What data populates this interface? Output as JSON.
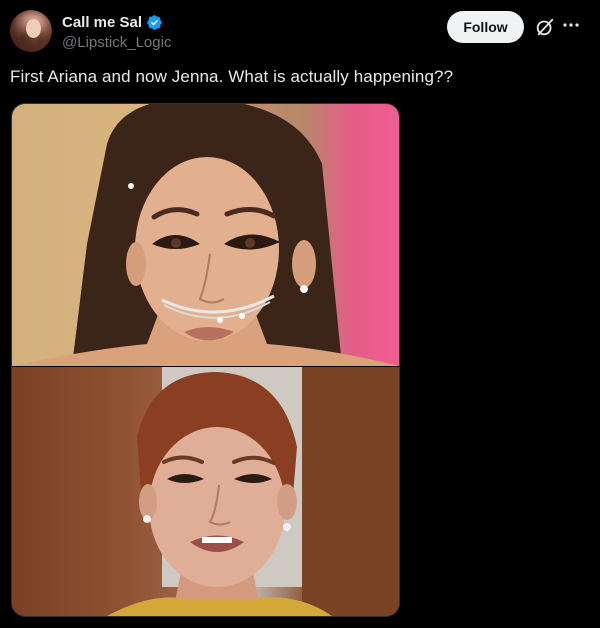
{
  "user": {
    "display_name": "Call me Sal",
    "handle": "@Lipstick_Logic",
    "verified": true
  },
  "actions": {
    "follow_label": "Follow",
    "grok_icon": "grok-icon",
    "more_icon": "more-icon"
  },
  "tweet": {
    "text": "First Ariana and now Jenna. What is actually happening??"
  },
  "media": {
    "count": 2,
    "images": [
      {
        "name": "photo-top"
      },
      {
        "name": "photo-bottom"
      }
    ]
  },
  "colors": {
    "background": "#000000",
    "primary_text": "#e7e9ea",
    "secondary_text": "#71767b",
    "verified": "#1d9bf0",
    "follow_button_bg": "#eff3f4"
  }
}
